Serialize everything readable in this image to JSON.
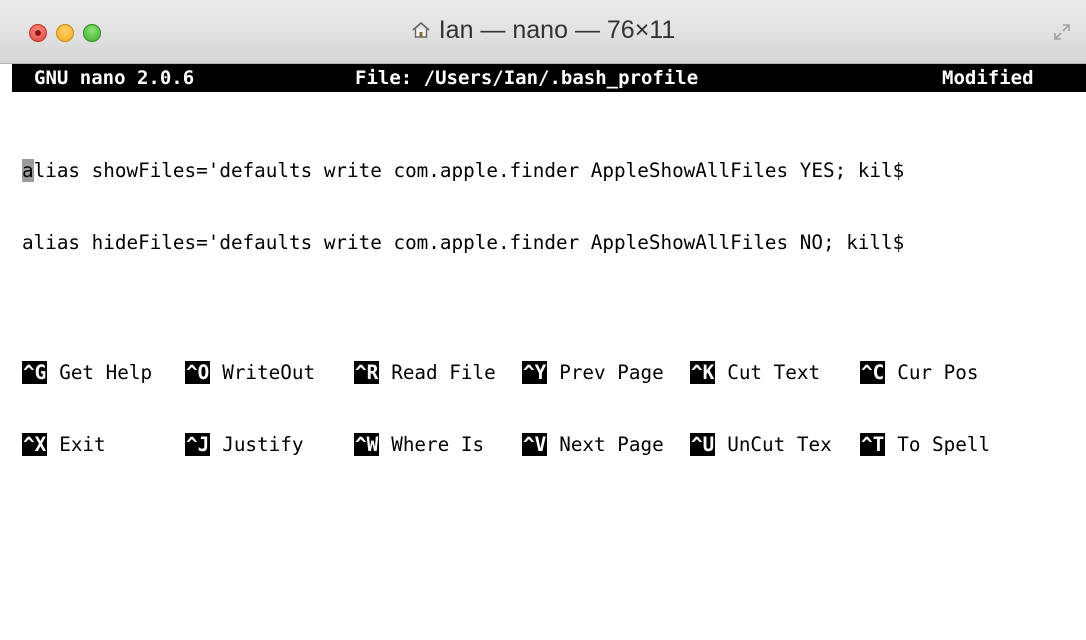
{
  "window": {
    "title": "Ian — nano — 76×11",
    "icons": {
      "home": "home-icon",
      "resize": "fullscreen-icon"
    }
  },
  "header": {
    "version": "GNU nano 2.0.6",
    "file": "File: /Users/Ian/.bash_profile",
    "status": "Modified"
  },
  "editor": {
    "cursor_char": "a",
    "lines": [
      "lias showFiles='defaults write com.apple.finder AppleShowAllFiles YES; kil$",
      "alias hideFiles='defaults write com.apple.finder AppleShowAllFiles NO; kill$"
    ]
  },
  "shortcuts": {
    "row1": [
      {
        "key": "^G",
        "label": "Get Help"
      },
      {
        "key": "^O",
        "label": "WriteOut"
      },
      {
        "key": "^R",
        "label": "Read File"
      },
      {
        "key": "^Y",
        "label": "Prev Page"
      },
      {
        "key": "^K",
        "label": "Cut Text"
      },
      {
        "key": "^C",
        "label": "Cur Pos"
      }
    ],
    "row2": [
      {
        "key": "^X",
        "label": "Exit"
      },
      {
        "key": "^J",
        "label": "Justify"
      },
      {
        "key": "^W",
        "label": "Where Is"
      },
      {
        "key": "^V",
        "label": "Next Page"
      },
      {
        "key": "^U",
        "label": "UnCut Tex"
      },
      {
        "key": "^T",
        "label": "To Spell"
      }
    ]
  }
}
